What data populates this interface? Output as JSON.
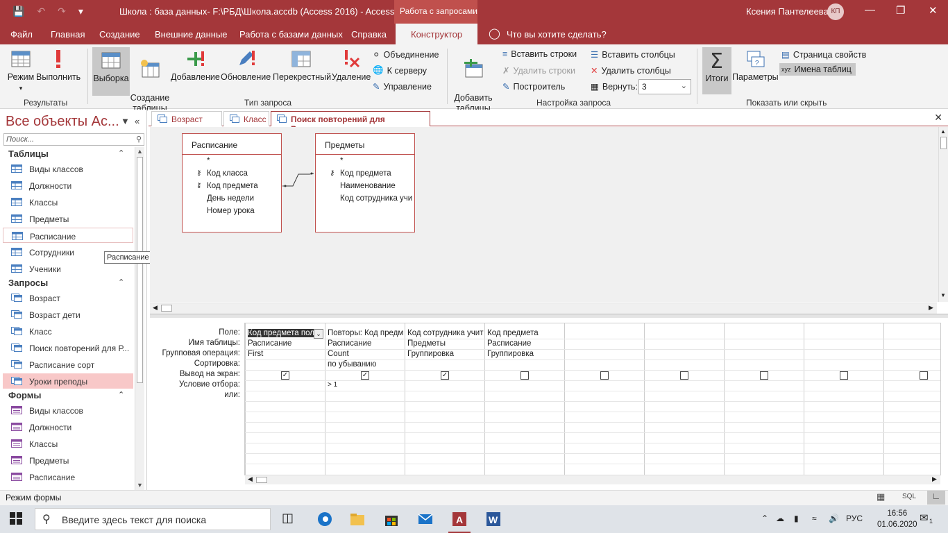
{
  "window": {
    "title": "Школа : база данных- F:\\РБД\\Школа.accdb (Access 2016)  -  Access",
    "context_tab_group": "Работа с запросами",
    "user_name": "Ксения Пантелеева",
    "user_initials": "КП"
  },
  "menu": {
    "items": [
      "Файл",
      "Главная",
      "Создание",
      "Внешние данные",
      "Работа с базами данных",
      "Справка"
    ],
    "active": "Конструктор",
    "tell_me": "Что вы хотите сделать?"
  },
  "ribbon": {
    "results": {
      "mode": "Режим",
      "run": "Выполнить",
      "group": "Результаты"
    },
    "query_type": {
      "select": "Выборка",
      "make_table": "Создание\nтаблицы",
      "append": "Добавление",
      "update": "Обновление",
      "crosstab": "Перекрестный",
      "delete": "Удаление",
      "union": "Объединение",
      "pass_through": "К серверу",
      "data_definition": "Управление",
      "group": "Тип запроса"
    },
    "query_setup": {
      "show_table": "Добавить\nтаблицы",
      "insert_rows": "Вставить строки",
      "delete_rows": "Удалить строки",
      "builder": "Построитель",
      "insert_columns": "Вставить столбцы",
      "delete_columns": "Удалить столбцы",
      "return_label": "Вернуть:",
      "return_value": "3",
      "group": "Настройка запроса"
    },
    "show_hide": {
      "totals": "Итоги",
      "parameters": "Параметры",
      "property_sheet": "Страница свойств",
      "table_names": "Имена таблиц",
      "group": "Показать или скрыть"
    }
  },
  "nav": {
    "header": "Все объекты Ac...",
    "search_placeholder": "Поиск...",
    "sections": [
      {
        "title": "Таблицы",
        "items": [
          "Виды классов",
          "Должности",
          "Классы",
          "Предметы",
          "Расписание",
          "Сотрудники",
          "Ученики"
        ]
      },
      {
        "title": "Запросы",
        "items": [
          "Возраст",
          "Возраст дети",
          "Класс",
          "Поиск повторений для Р...",
          "Расписание сорт",
          "Уроки преподы"
        ]
      },
      {
        "title": "Формы",
        "items": [
          "Виды классов",
          "Должности",
          "Классы",
          "Предметы",
          "Расписание"
        ]
      }
    ],
    "tooltip": "Расписание"
  },
  "doc_tabs": [
    "Возраст дети",
    "Класс",
    "Поиск повторений для Расписание"
  ],
  "diagram": {
    "tables": [
      {
        "name": "Расписание",
        "fields": [
          {
            "name": "*",
            "key": false
          },
          {
            "name": "Код класса",
            "key": true
          },
          {
            "name": "Код предмета",
            "key": true
          },
          {
            "name": "День недели",
            "key": false
          },
          {
            "name": "Номер урока",
            "key": false
          }
        ]
      },
      {
        "name": "Предметы",
        "fields": [
          {
            "name": "*",
            "key": false
          },
          {
            "name": "Код предмета",
            "key": true
          },
          {
            "name": "Наименование",
            "key": false
          },
          {
            "name": "Код сотрудника учи",
            "key": false
          }
        ]
      }
    ]
  },
  "grid": {
    "row_labels": [
      "Поле:",
      "Имя таблицы:",
      "Групповая операция:",
      "Сортировка:",
      "Вывод на экран:",
      "Условие отбора:",
      "или:"
    ],
    "columns": [
      {
        "field": "Код предмета пол",
        "table": "Расписание",
        "total": "First",
        "sort": "",
        "show": true,
        "criteria": ""
      },
      {
        "field": "Повторы: Код предм",
        "table": "Расписание",
        "total": "Count",
        "sort": "по убыванию",
        "show": true,
        "criteria": "> 1"
      },
      {
        "field": "Код сотрудника учит",
        "table": "Предметы",
        "total": "Группировка",
        "sort": "",
        "show": true,
        "criteria": ""
      },
      {
        "field": "Код предмета",
        "table": "Расписание",
        "total": "Группировка",
        "sort": "",
        "show": false,
        "criteria": ""
      },
      {
        "field": "",
        "table": "",
        "total": "",
        "sort": "",
        "show": false,
        "criteria": ""
      },
      {
        "field": "",
        "table": "",
        "total": "",
        "sort": "",
        "show": false,
        "criteria": ""
      },
      {
        "field": "",
        "table": "",
        "total": "",
        "sort": "",
        "show": false,
        "criteria": ""
      },
      {
        "field": "",
        "table": "",
        "total": "",
        "sort": "",
        "show": false,
        "criteria": ""
      },
      {
        "field": "",
        "table": "",
        "total": "",
        "sort": "",
        "show": false,
        "criteria": ""
      }
    ]
  },
  "status": {
    "text": "Режим формы",
    "sql_label": "SQL"
  },
  "taskbar": {
    "search_placeholder": "Введите здесь текст для поиска",
    "lang": "РУС",
    "time": "16:56",
    "date": "01.06.2020",
    "notifications": "1"
  },
  "colors": {
    "accent": "#a4373a",
    "context": "#c0504d"
  }
}
